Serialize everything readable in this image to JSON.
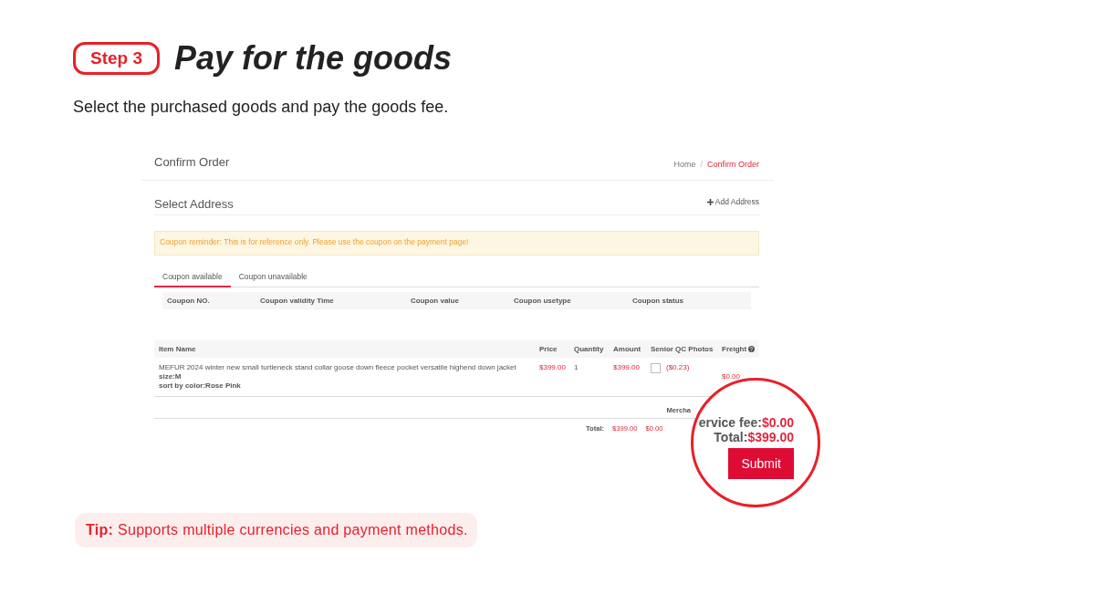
{
  "step": {
    "badge": "Step 3",
    "title": "Pay for the goods",
    "subtitle": "Select the purchased goods and pay the goods fee."
  },
  "order": {
    "title": "Confirm Order",
    "breadcrumb_separator": "/",
    "breadcrumb": [
      {
        "label": "Home",
        "selected": false
      },
      {
        "label": "Confirm Order",
        "selected": true
      }
    ],
    "address_title": "Select Address",
    "add_address": "Add Address",
    "notice": "Coupon reminder: This is for reference only. Please use the coupon on the payment page!",
    "tabs": [
      {
        "label": "Coupon available",
        "selected": true
      },
      {
        "label": "Coupon unavailable",
        "selected": false
      }
    ],
    "coupon_columns": [
      "Coupon NO.",
      "Coupon validity Time",
      "Coupon value",
      "Coupon usetype",
      "Coupon status"
    ],
    "item_columns": [
      "Item Name",
      "Price",
      "Quantity",
      "Amount",
      "Senior QC Photos",
      "Freight"
    ],
    "items": [
      {
        "name": "MEFUR 2024 winter new small turtleneck stand collar goose down fleece pocket versatile highend down jacket",
        "size": "size:M",
        "variant": "sort by color:Rose Pink",
        "price": "$399.00",
        "quantity": "1",
        "amount": "$399.00",
        "qc_checked": false,
        "qc_price": "($0.23)",
        "freight": "$0.00"
      }
    ],
    "merchandise_label": "Mercha",
    "totals": {
      "label": "Total:",
      "amount": "$399.00",
      "freight": "$0.00"
    }
  },
  "magnifier": {
    "service_label": "ervice fee:",
    "service_value": "$0.00",
    "total_label": "Total:",
    "total_value": "$399.00",
    "button": "Submit"
  },
  "tip": "**Tip:** Supports multiple currencies and payment methods."
}
